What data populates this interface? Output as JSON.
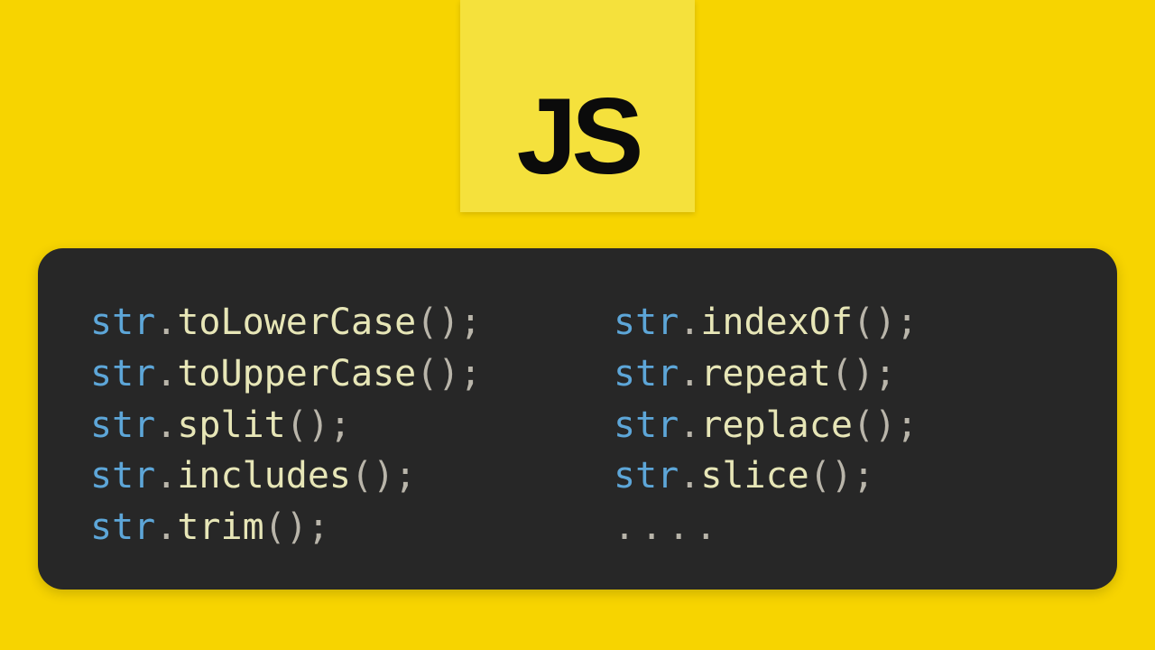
{
  "logo": {
    "text": "JS"
  },
  "code": {
    "obj": "str",
    "dot": ".",
    "parens": "()",
    "semi": ";",
    "ellipsis": "....",
    "left": [
      {
        "method": "toLowerCase"
      },
      {
        "method": "toUpperCase"
      },
      {
        "method": "split"
      },
      {
        "method": "includes"
      },
      {
        "method": "trim"
      }
    ],
    "right": [
      {
        "method": "indexOf"
      },
      {
        "method": "repeat"
      },
      {
        "method": "replace"
      },
      {
        "method": "slice"
      }
    ]
  }
}
